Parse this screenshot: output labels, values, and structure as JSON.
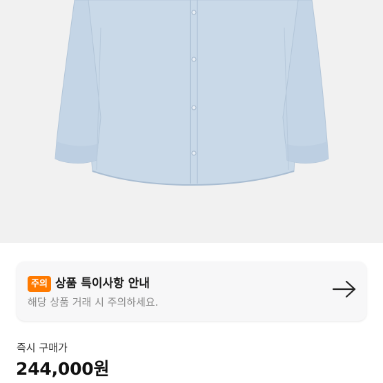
{
  "product": {
    "image_description_icon": "shirt-image"
  },
  "notice": {
    "badge": "주의",
    "title": "상품 특이사항 안내",
    "description": "해당 상품 거래 시 주의하세요.",
    "arrow_icon": "arrow-right-icon",
    "badge_color": "#ff7a00"
  },
  "purchase": {
    "label": "즉시 구매가",
    "price": "244,000원"
  }
}
